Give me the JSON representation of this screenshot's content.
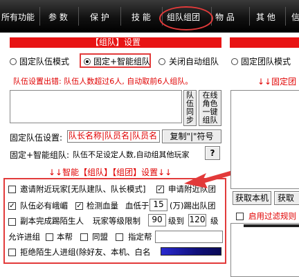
{
  "menu": {
    "items": [
      "所有功能",
      "参 数",
      "保 护",
      "技 能",
      "组队组团",
      "物 品",
      "其 他",
      "信"
    ]
  },
  "left_panel": {
    "header": "【组队】设置",
    "radio_fixed_team": "固定队伍模式",
    "radio_fixed_smart": "固定+智能组队",
    "radio_close_auto": "关闭自动组队",
    "error_text": "队伍设置出错: 队伍人数超过6人, 自动取前6人组队。",
    "sync_button": "队伍同步",
    "online_button": "在线角色一键组队",
    "fixed_team_label": "固定队伍设置:",
    "fixed_team_value": "队长名称|队员名|队员名",
    "copy_button": "复制\"|\"符号",
    "smart_label": "固定+智能组队:",
    "smart_desc": "队伍不足设定人数,自动组其他玩家",
    "help_button": "?",
    "section_title": "↓↓智能【组队】【组团】设置↓↓",
    "invite_nearby": "邀请附近玩家[无队建队、队长模式]",
    "apply_nearby": "申请附近队团",
    "need_emei": "队伍必有峨嵋",
    "check_hp": "检测血量",
    "hp_below_label": "血低于",
    "hp_below_value": "15",
    "hp_unit": "(万)踢出队团",
    "dungeon_kick": "副本完成踢陌生人",
    "level_limit_label": "玩家等级限制",
    "level_min": "90",
    "level_to": "级到",
    "level_max": "120",
    "level_unit": "级",
    "allow_join_label": "允许进组",
    "own_gang": "本帮",
    "alliance": "同盟",
    "specified_gang": "指定帮",
    "reject_strangers": "拒绝陌生人进组(除好友、本机、白名"
  },
  "right_panel": {
    "radio_fixed_group": "固定团队模式",
    "error_text": "↓↓固定团",
    "tab_this_machine": "获取本机",
    "tab_get": "获取",
    "enable_filter": "启用过滤规则"
  },
  "colors": {
    "accent_red": "#e81414",
    "highlight_red": "#e23a3a",
    "menubar_bg": "#111111"
  }
}
